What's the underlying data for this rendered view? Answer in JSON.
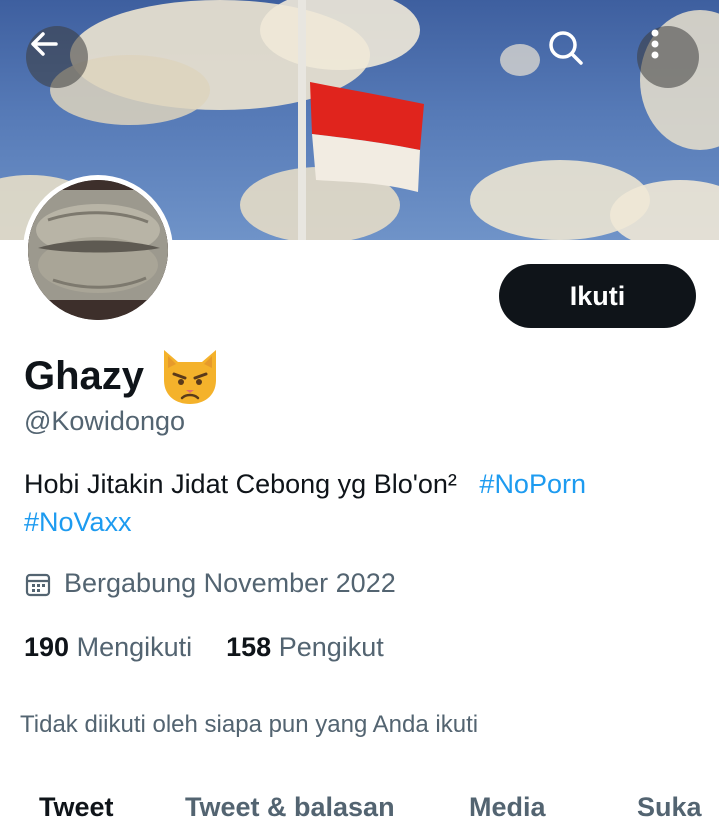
{
  "header": {
    "back_icon": "arrow-left-icon",
    "search_icon": "search-icon",
    "more_icon": "more-vertical-icon"
  },
  "profile": {
    "display_name": "Ghazy",
    "emoji": "😾",
    "handle": "@Kowidongo",
    "follow_label": "Ikuti",
    "bio_text": "Hobi Jitakin Jidat Cebong yg Blo'on²",
    "bio_hashtags": [
      "#NoPorn",
      "#NoVaxx"
    ],
    "joined_icon": "calendar-icon",
    "joined_text": "Bergabung November 2022",
    "following_count": "190",
    "following_label": "Mengikuti",
    "followers_count": "158",
    "followers_label": "Pengikut",
    "followed_by_text": "Tidak diikuti oleh siapa pun yang Anda ikuti"
  },
  "tabs": [
    "Tweet",
    "Tweet & balasan",
    "Media",
    "Suka"
  ],
  "colors": {
    "accent": "#1d9bf0",
    "text": "#0f1419",
    "muted": "#536471",
    "button": "#0f1419"
  }
}
